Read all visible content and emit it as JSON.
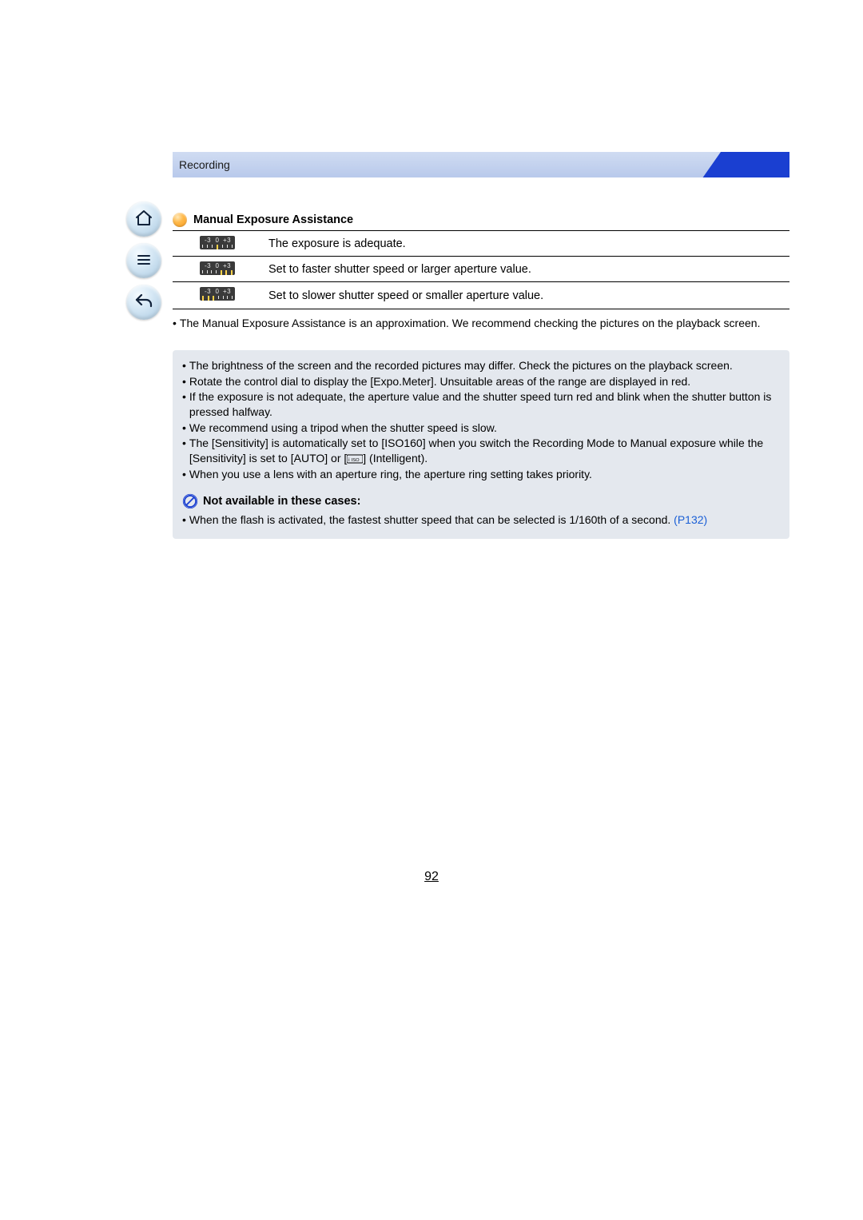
{
  "header": {
    "breadcrumb": "Recording"
  },
  "section": {
    "title": "Manual Exposure Assistance"
  },
  "table": {
    "rows": [
      {
        "meter_highlight": "center",
        "text": "The exposure is adequate."
      },
      {
        "meter_highlight": "right",
        "text": "Set to faster shutter speed or larger aperture value."
      },
      {
        "meter_highlight": "left",
        "text": "Set to slower shutter speed or smaller aperture value."
      }
    ],
    "meter_labels": [
      "-3",
      "0",
      "+3"
    ]
  },
  "post_table_note": "The Manual Exposure Assistance is an approximation. We recommend checking the pictures on the playback screen.",
  "notes": {
    "items": [
      "The brightness of the screen and the recorded pictures may differ. Check the pictures on the playback screen.",
      "Rotate the control dial to display the [Expo.Meter]. Unsuitable areas of the range are displayed in red.",
      "If the exposure is not adequate, the aperture value and the shutter speed turn red and blink when the shutter button is pressed halfway.",
      "We recommend using a tripod when the shutter speed is slow."
    ],
    "sensitivity_pre": "The [Sensitivity] is automatically set to [ISO160] when you switch the Recording Mode to Manual exposure while the [Sensitivity] is set to [AUTO] or [",
    "sensitivity_icon_label": "iISO",
    "sensitivity_post": "] (Intelligent).",
    "aperture_ring": "When you use a lens with an aperture ring, the aperture ring setting takes priority."
  },
  "not_available": {
    "title": "Not available in these cases:",
    "text_pre": "When the flash is activated, the fastest shutter speed that can be selected is 1/160th of a second. ",
    "link": "(P132)"
  },
  "page_number": "92"
}
